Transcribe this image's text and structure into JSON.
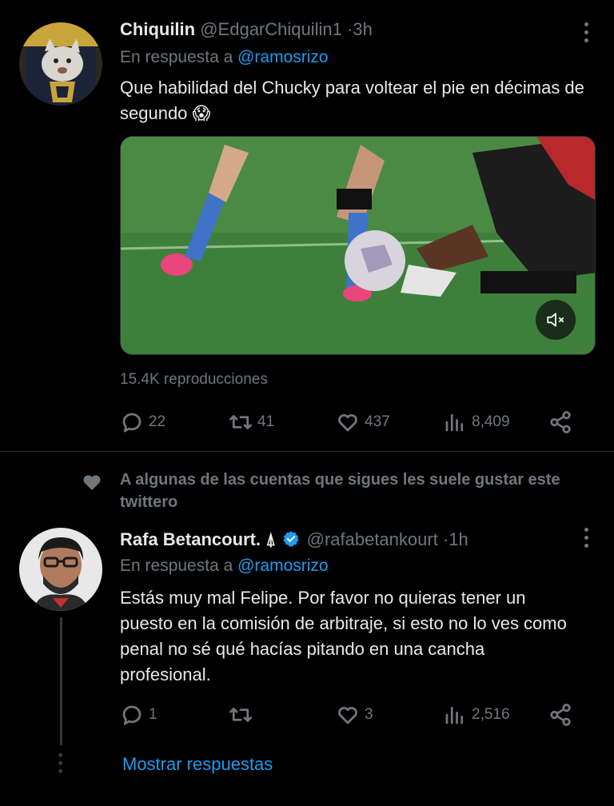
{
  "tweet1": {
    "name": "Chiquilin",
    "handle": "@EdgarChiquilin1",
    "sep": "·",
    "time": "3h",
    "reply_prefix": "En respuesta a",
    "reply_to": "@ramosrizo",
    "text": "Que habilidad del Chucky para voltear el pie en décimas de segundo 😱",
    "views": "15.4K reproducciones",
    "stats": {
      "replies": "22",
      "retweets": "41",
      "likes": "437",
      "views": "8,409"
    }
  },
  "social_context": "A algunas de las cuentas que sigues les suele gustar este twittero",
  "tweet2": {
    "name": "Rafa Betancourt. ⍋",
    "handle": "@rafabetankourt",
    "sep": "·",
    "time": "1h",
    "reply_prefix": "En respuesta a",
    "reply_to": "@ramosrizo",
    "text": "Estás muy mal Felipe. Por favor no quieras tener un puesto en la comisión de arbitraje, si esto no lo ves como penal no sé qué hacías pitando en una cancha profesional.",
    "stats": {
      "replies": "1",
      "retweets": "",
      "likes": "3",
      "views": "2,516"
    }
  },
  "show_replies": "Mostrar respuestas",
  "colors": {
    "accent": "#1d9bf0",
    "muted": "#71767b",
    "background": "#000000",
    "verified": "#1d9bf0"
  }
}
